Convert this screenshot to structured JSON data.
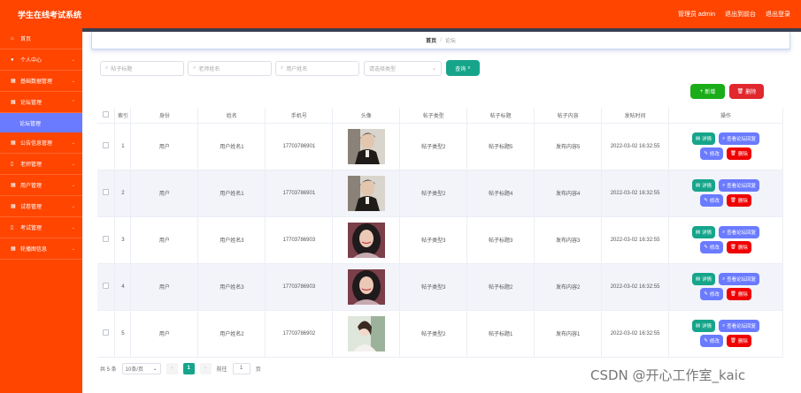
{
  "header": {
    "app_title": "学生在线考试系统",
    "user_label": "管理员 admin",
    "back_label": "退出到前台",
    "logout_label": "退出登录"
  },
  "sidebar": {
    "items": [
      {
        "label": "首页",
        "icon": "home-icon"
      },
      {
        "label": "个人中心",
        "icon": "user-icon"
      },
      {
        "label": "基础数据管理",
        "icon": "grid-icon"
      },
      {
        "label": "论坛管理",
        "icon": "grid-icon"
      },
      {
        "label": "公告信息管理",
        "icon": "grid-icon"
      },
      {
        "label": "老师管理",
        "icon": "doc-icon"
      },
      {
        "label": "用户管理",
        "icon": "grid-icon"
      },
      {
        "label": "试卷管理",
        "icon": "grid-icon"
      },
      {
        "label": "考试管理",
        "icon": "doc-icon"
      },
      {
        "label": "轮播图信息",
        "icon": "grid-icon"
      }
    ],
    "active_sub": "论坛管理"
  },
  "breadcrumb": {
    "home": "首页",
    "sep": "/",
    "current": "论坛"
  },
  "search": {
    "post_title_placeholder": "帖子标题",
    "teacher_placeholder": "老师姓名",
    "user_placeholder": "用户姓名",
    "type_placeholder": "请选择类型",
    "query_label": "查询"
  },
  "actions": {
    "add_label": "新增",
    "delete_label": "删除"
  },
  "table": {
    "headers": [
      "索引",
      "身份",
      "姓名",
      "手机号",
      "头像",
      "帖子类型",
      "帖子标题",
      "帖子内容",
      "发帖时间",
      "操作"
    ],
    "rows": [
      {
        "index": "1",
        "role": "用户",
        "name": "用户姓名1",
        "phone": "17703786901",
        "avatar": "man",
        "type": "帖子类型2",
        "title": "帖子标题5",
        "content": "发布内容5",
        "time": "2022-03-02 16:32:55"
      },
      {
        "index": "2",
        "role": "用户",
        "name": "用户姓名1",
        "phone": "17703786901",
        "avatar": "man",
        "type": "帖子类型2",
        "title": "帖子标题4",
        "content": "发布内容4",
        "time": "2022-03-02 16:32:55"
      },
      {
        "index": "3",
        "role": "用户",
        "name": "用户姓名3",
        "phone": "17703786903",
        "avatar": "woman",
        "type": "帖子类型3",
        "title": "帖子标题3",
        "content": "发布内容3",
        "time": "2022-03-02 16:32:55"
      },
      {
        "index": "4",
        "role": "用户",
        "name": "用户姓名3",
        "phone": "17703786903",
        "avatar": "woman",
        "type": "帖子类型3",
        "title": "帖子标题2",
        "content": "发布内容2",
        "time": "2022-03-02 16:32:55"
      },
      {
        "index": "5",
        "role": "用户",
        "name": "用户姓名2",
        "phone": "17703786902",
        "avatar": "girl",
        "type": "帖子类型2",
        "title": "帖子标题1",
        "content": "发布内容1",
        "time": "2022-03-02 16:32:55"
      }
    ],
    "op_detail": "详情",
    "op_reply": "查看论坛回复",
    "op_edit": "修改",
    "op_delete": "删除"
  },
  "pager": {
    "total": "共 5 条",
    "size": "10条/页",
    "page": "1",
    "goto": "前往",
    "goto_value": "1",
    "unit": "页"
  },
  "watermark": "CSDN @开心工作室_kaic",
  "colors": {
    "primary": "#ff4500",
    "teal": "#16a58a",
    "blue": "#6b7bff",
    "red": "#f00000",
    "green": "#1aad19"
  }
}
